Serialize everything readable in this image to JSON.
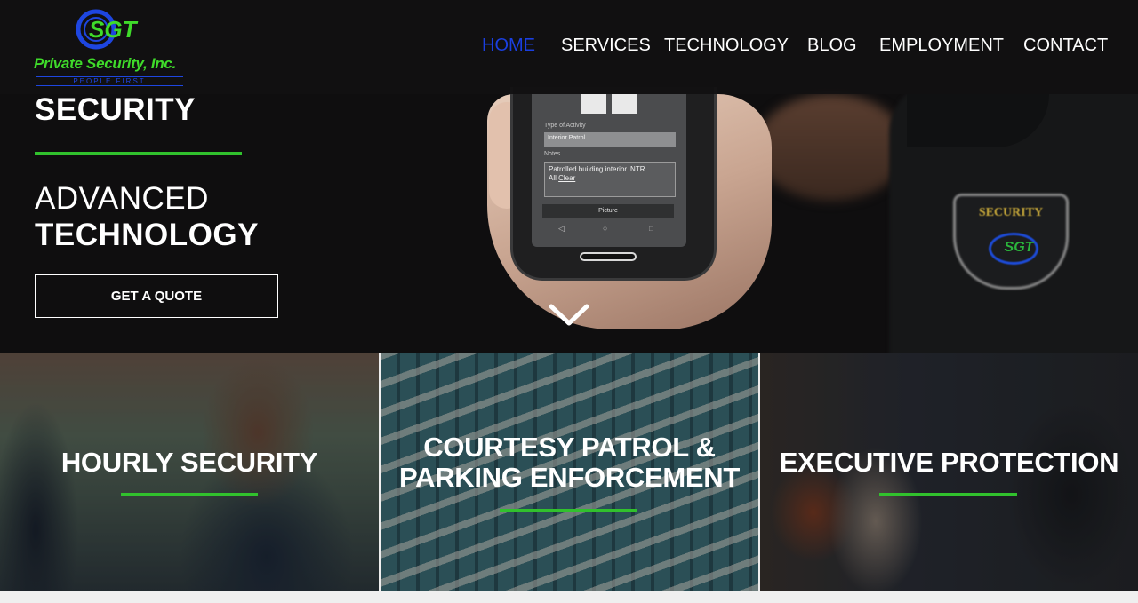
{
  "header": {
    "logo": {
      "mark_text": "SGT",
      "company_name": "Private Security, Inc.",
      "tagline": "PEOPLE FIRST"
    },
    "nav": [
      {
        "label": "HOME",
        "active": true
      },
      {
        "label": "SERVICES",
        "active": false
      },
      {
        "label": "TECHNOLOGY",
        "active": false
      },
      {
        "label": "BLOG",
        "active": false
      },
      {
        "label": "EMPLOYMENT",
        "active": false
      },
      {
        "label": "CONTACT",
        "active": false
      }
    ]
  },
  "hero": {
    "title_top": "SECURITY",
    "title_light": "ADVANCED",
    "title_bold": "TECHNOLOGY",
    "cta_label": "GET A QUOTE",
    "scroll_icon": "chevron-down-icon",
    "phone_screen": {
      "activity_label": "Type of Activity",
      "activity_value": "Interior Patrol",
      "notes_label": "Notes",
      "notes_line1": "Patrolled building interior.  NTR.",
      "notes_line2a": "All ",
      "notes_line2b": "Clear",
      "picture_button": "Picture"
    },
    "patch": {
      "title": "SECURITY",
      "logo_text": "SGT"
    }
  },
  "services": [
    {
      "title": "HOURLY SECURITY"
    },
    {
      "title_line1": "COURTESY PATROL &",
      "title_line2": "PARKING ENFORCEMENT"
    },
    {
      "title": "EXECUTIVE PROTECTION"
    }
  ],
  "colors": {
    "accent_green": "#31c12d",
    "nav_active_blue": "#1a3fe0",
    "logo_green": "#3fdb2a",
    "logo_blue": "#1e46e0",
    "header_bg": "#111011"
  }
}
